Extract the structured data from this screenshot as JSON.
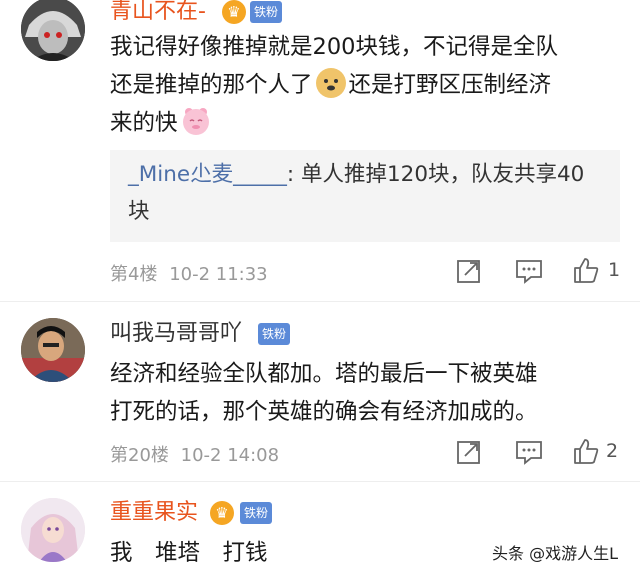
{
  "comments": [
    {
      "username": "青山不在-",
      "badge": "铁粉",
      "crown_icon": "crown-icon",
      "text_line1": "我记得好像推掉就是200块钱，不记得是全队",
      "text_line2a": "还是推掉的那个人了",
      "emoji1": "doge-emoji",
      "text_line2b": "还是打野区压制经济",
      "text_line3": "来的快",
      "emoji2": "pig-emoji",
      "reply": {
        "user": "_Mine尐麦_____",
        "text": ": 单人推掉120块，队友共享40块"
      },
      "floor": "第4楼",
      "time": "10-2 11:33",
      "likes": "1"
    },
    {
      "username": "叫我马哥哥吖",
      "badge": "铁粉",
      "text_line1": "经济和经验全队都加。塔的最后一下被英雄",
      "text_line2": "打死的话，那个英雄的确会有经济加成的。",
      "floor": "第20楼",
      "time": "10-2 14:08",
      "likes": "2"
    },
    {
      "username": "重重果实",
      "badge": "铁粉",
      "crown_icon": "crown-icon",
      "text": "我　堆塔　打钱"
    }
  ],
  "watermark": "头条 @戏游人生L",
  "colors": {
    "vip_name": "#e8541e",
    "badge_bg": "#5b8ad8",
    "reply_user": "#4d6fa8",
    "meta": "#999999"
  }
}
